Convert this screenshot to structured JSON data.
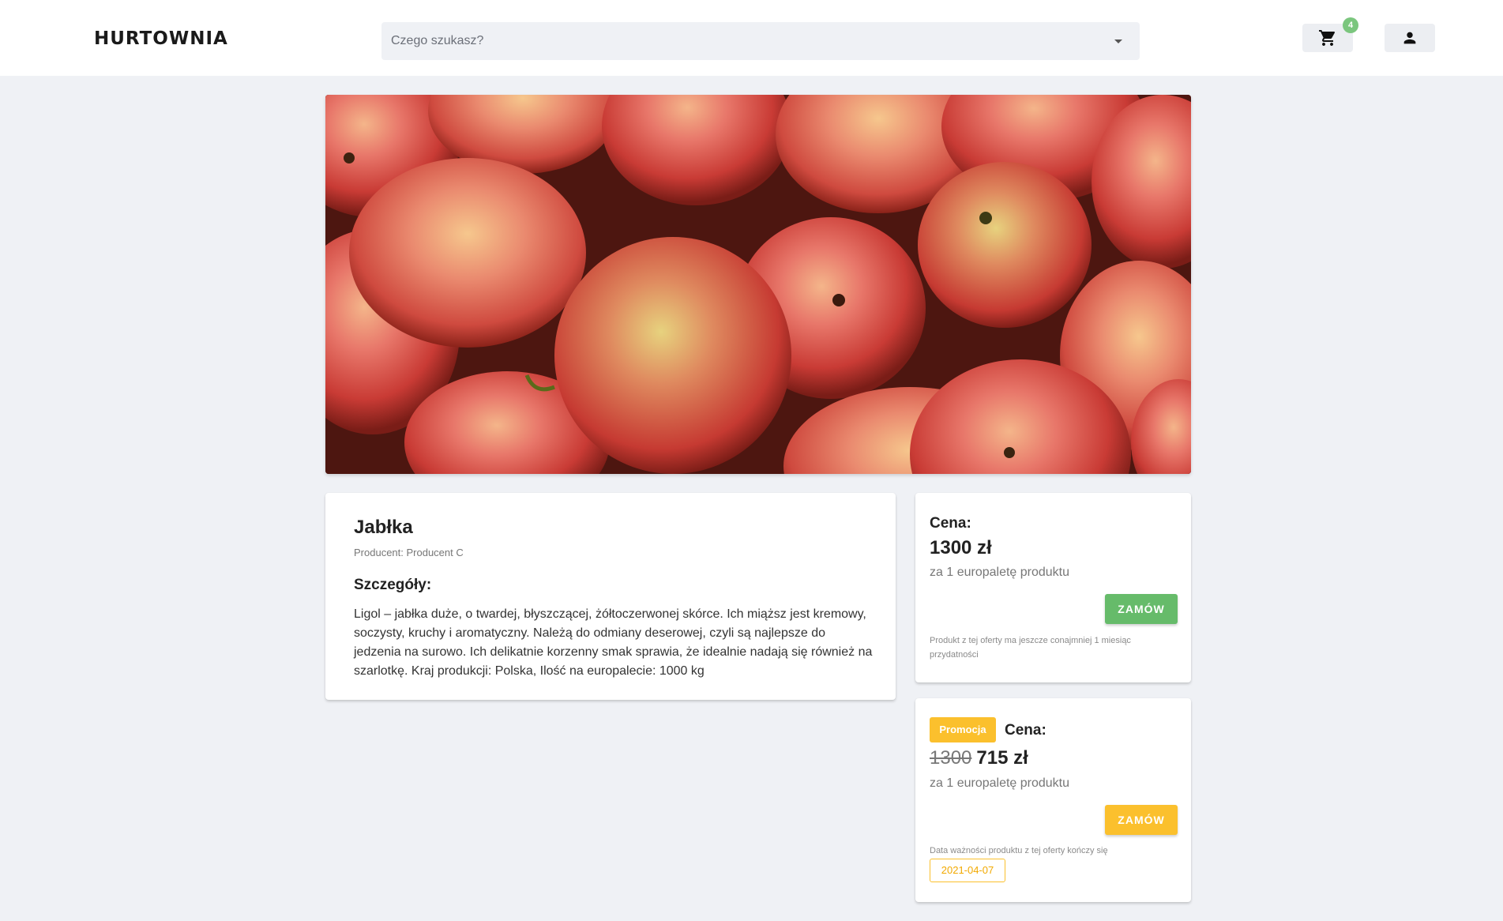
{
  "header": {
    "logo": "HURTOWNIA",
    "search": {
      "placeholder": "Czego szukasz?"
    },
    "cart": {
      "icon": "cart-icon",
      "badge_count": "4",
      "badge_color": "#7bc67e"
    },
    "user": {
      "icon": "person-icon"
    }
  },
  "product": {
    "image": {
      "subject": "red-apples"
    },
    "name": "Jabłka",
    "producer": "Producent: Producent C",
    "details_heading": "Szczegóły:",
    "description": "Ligol – jabłka duże, o twardej, błyszczącej, żółtoczerwonej skórce. Ich miąższ jest kremowy, soczysty, kruchy i aromatyczny. Należą do odmiany deserowej, czyli są najlepsze do jedzenia na surowo. Ich delikatnie korzenny smak sprawia, że idealnie nadają się również na szarlotkę. Kraj produkcji: Polska, Ilość na europalecie: 1000 kg"
  },
  "offers": [
    {
      "price_label": "Cena:",
      "price": "1300 zł",
      "unit": "za 1 europaletę produktu",
      "order_label": "ZAMÓW",
      "button_color": "#66bb6a",
      "note": "Produkt z tej oferty ma jeszcze conajmniej 1 miesiąc przydatności"
    },
    {
      "promo_label": "Promocja",
      "price_label": "Cena:",
      "old_price": "1300",
      "price": "715 zł",
      "unit": "za 1 europaletę produktu",
      "order_label": "ZAMÓW",
      "button_color": "#fbc02d",
      "note": "Data ważności produktu z tej oferty kończy się",
      "expiry_date": "2021-04-07"
    }
  ]
}
